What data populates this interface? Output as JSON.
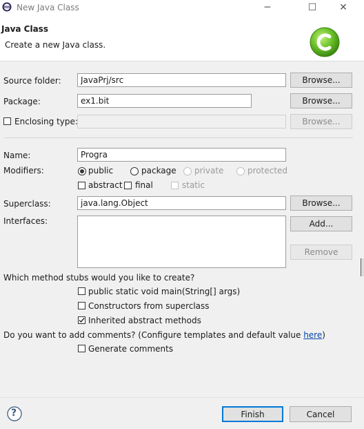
{
  "window": {
    "title": "New Java Class",
    "minimize_glyph": "─",
    "maximize_glyph": "☐",
    "close_glyph": "✕"
  },
  "header": {
    "title": "Java Class",
    "subtitle": "Create a new Java class."
  },
  "form": {
    "source_folder": {
      "label": "Source folder:",
      "value": "JavaPrj/src",
      "browse": "Browse..."
    },
    "package": {
      "label": "Package:",
      "value": "ex1.bit",
      "browse": "Browse..."
    },
    "enclosing": {
      "label": "Enclosing type:",
      "value": "",
      "checked": false,
      "browse": "Browse..."
    },
    "name": {
      "label": "Name:",
      "value": "Progra"
    },
    "modifiers": {
      "label": "Modifiers:",
      "public": "public",
      "package": "package",
      "private": "private",
      "protected": "protected",
      "selected": "public",
      "abstract": "abstract",
      "final": "final",
      "static": "static"
    },
    "superclass": {
      "label": "Superclass:",
      "value": "java.lang.Object",
      "browse": "Browse..."
    },
    "interfaces": {
      "label": "Interfaces:",
      "add": "Add...",
      "remove": "Remove"
    },
    "stubs": {
      "question": "Which method stubs would you like to create?",
      "main": {
        "label": "public static void main(String[] args)",
        "checked": false
      },
      "constructors": {
        "label": "Constructors from superclass",
        "checked": false
      },
      "inherited": {
        "label": "Inherited abstract methods",
        "checked": true
      }
    },
    "comments": {
      "question_pre": "Do you want to add comments? (Configure templates and default value ",
      "link": "here",
      "question_post": ")",
      "generate": {
        "label": "Generate comments",
        "checked": false
      }
    }
  },
  "footer": {
    "help_glyph": "?",
    "finish": "Finish",
    "cancel": "Cancel"
  },
  "colors": {
    "accent": "#0078d7",
    "link": "#0645ad",
    "logo_green": "#5fb820"
  }
}
